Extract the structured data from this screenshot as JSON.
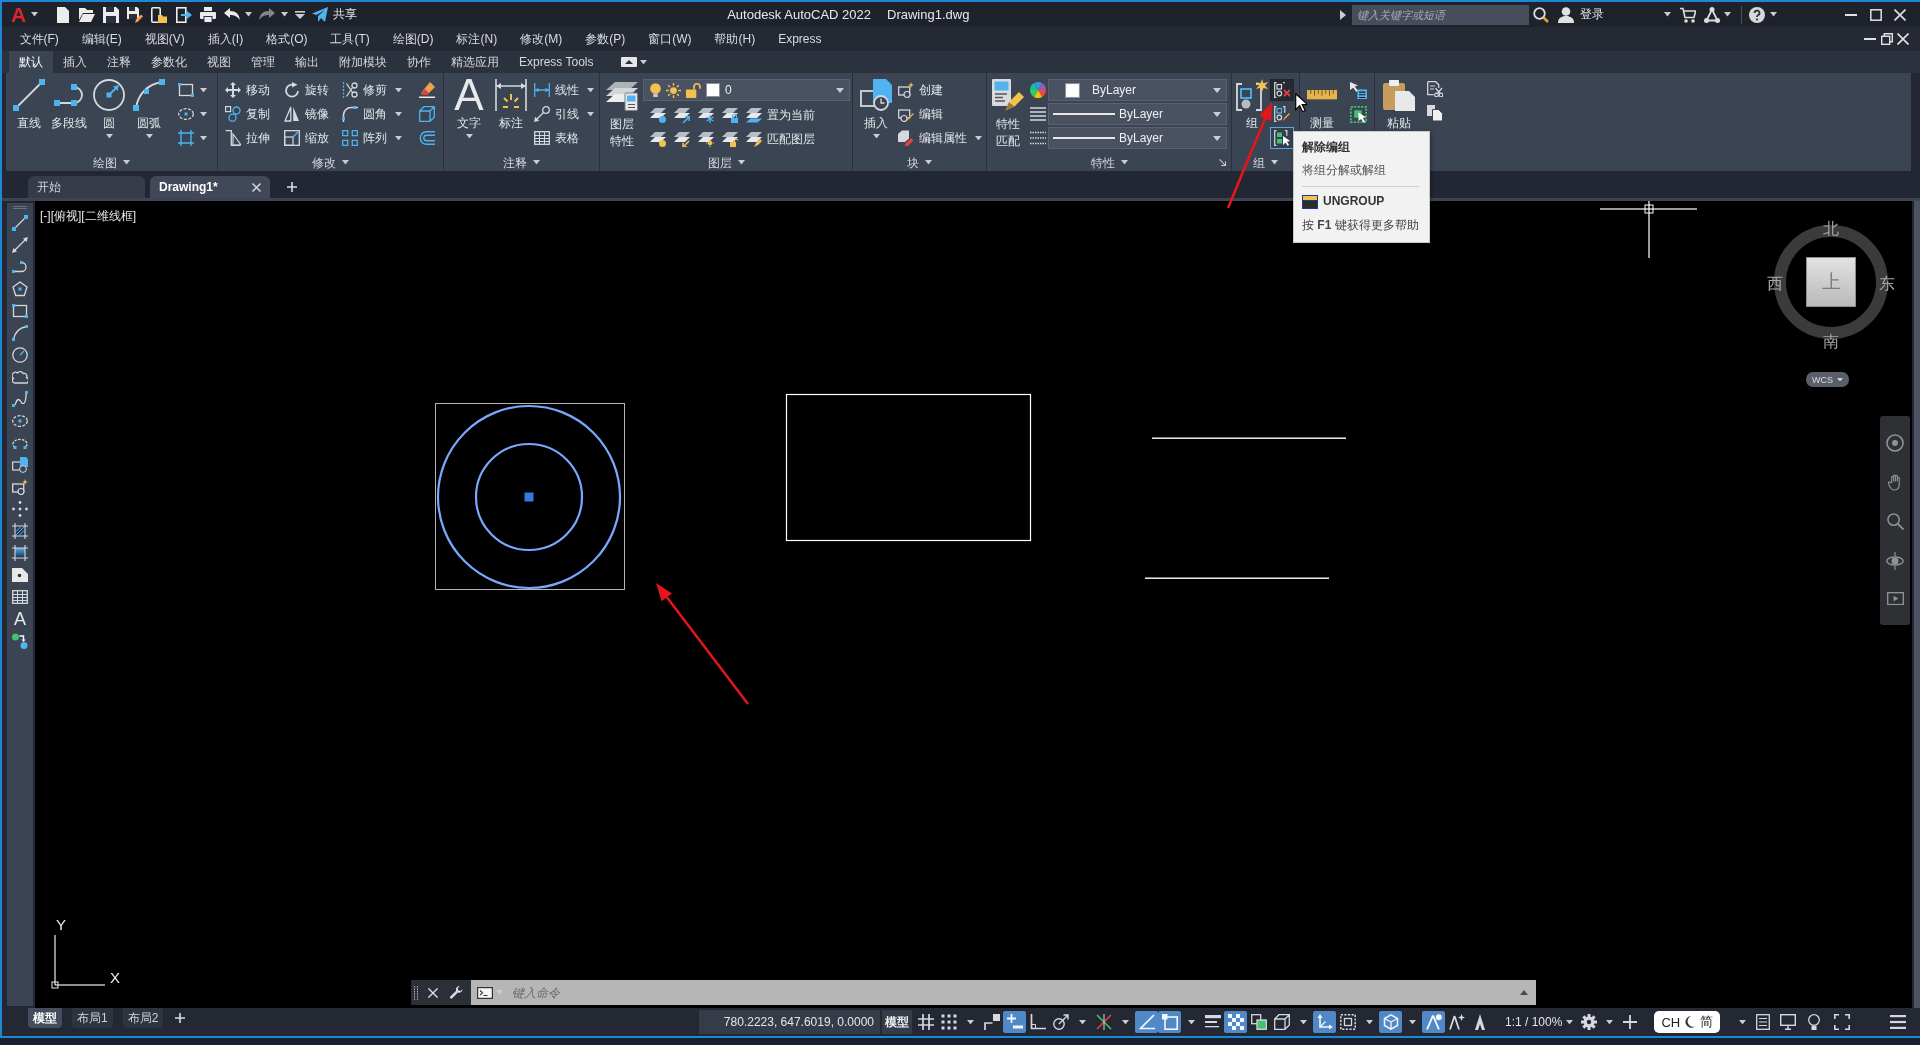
{
  "title_bar": {
    "logo": "A",
    "share_label": "共享",
    "app_title": "Autodesk AutoCAD 2022",
    "document_title": "Drawing1.dwg",
    "search": {
      "placeholder": "键入关键字或短语"
    },
    "sign_in": "登录"
  },
  "menu_bar": [
    "文件(F)",
    "编辑(E)",
    "视图(V)",
    "插入(I)",
    "格式(O)",
    "工具(T)",
    "绘图(D)",
    "标注(N)",
    "修改(M)",
    "参数(P)",
    "窗口(W)",
    "帮助(H)",
    "Express"
  ],
  "ribbon": {
    "tabs": [
      {
        "label": "默认",
        "selected": true
      },
      {
        "label": "插入",
        "selected": false
      },
      {
        "label": "注释",
        "selected": false
      },
      {
        "label": "参数化",
        "selected": false
      },
      {
        "label": "视图",
        "selected": false
      },
      {
        "label": "管理",
        "selected": false
      },
      {
        "label": "输出",
        "selected": false
      },
      {
        "label": "附加模块",
        "selected": false
      },
      {
        "label": "协作",
        "selected": false
      },
      {
        "label": "精选应用",
        "selected": false
      },
      {
        "label": "Express Tools",
        "selected": false
      }
    ],
    "draw": {
      "title": "绘图",
      "tools": [
        {
          "label": "直线",
          "dropdown": false
        },
        {
          "label": "多段线",
          "dropdown": false
        },
        {
          "label": "圆",
          "dropdown": true
        },
        {
          "label": "圆弧",
          "dropdown": true
        }
      ]
    },
    "modify": {
      "title": "修改",
      "tools": [
        {
          "label": "移动",
          "dropdown": false
        },
        {
          "label": "旋转",
          "dropdown": false
        },
        {
          "label": "修剪",
          "dropdown": true
        },
        {
          "label": "复制",
          "dropdown": false
        },
        {
          "label": "镜像",
          "dropdown": false
        },
        {
          "label": "圆角",
          "dropdown": true
        },
        {
          "label": "拉伸",
          "dropdown": false
        },
        {
          "label": "缩放",
          "dropdown": false
        },
        {
          "label": "阵列",
          "dropdown": true
        }
      ]
    },
    "annotation": {
      "title": "注释",
      "text_tool": {
        "glyph": "A",
        "label": "文字",
        "dropdown": true
      },
      "dimension_tool": {
        "label": "标注",
        "dropdown": false
      },
      "tools": [
        {
          "label": "线性",
          "dropdown": true
        },
        {
          "label": "引线",
          "dropdown": true
        },
        {
          "label": "表格",
          "dropdown": false
        }
      ]
    },
    "layers": {
      "title": "图层",
      "properties_tool": "图层特性",
      "current_layer": "0",
      "tools": [
        "置为当前",
        "匹配图层"
      ]
    },
    "block": {
      "title": "块",
      "insert_tool": {
        "label": "插入",
        "dropdown": true
      },
      "tools": [
        {
          "label": "创建",
          "dropdown": false
        },
        {
          "label": "编辑",
          "dropdown": false
        },
        {
          "label": "编辑属性",
          "dropdown": true
        }
      ]
    },
    "properties": {
      "title": "特性",
      "match_tool": "特性匹配",
      "object_color": "ByLayer",
      "linetype": "ByLayer",
      "lineweight": "ByLayer"
    },
    "groups": {
      "title": "组",
      "group_tool": "组",
      "tools": [
        {
          "hovered": true,
          "on": false
        },
        {
          "hovered": false,
          "on": false
        },
        {
          "hovered": false,
          "on": true
        }
      ]
    },
    "utilities": {
      "measure_tool": "测量"
    },
    "clipboard": {
      "paste_tool": "粘贴"
    }
  },
  "tooltip": {
    "title": "解除编组",
    "description": "将组分解或解组",
    "command": "UNGROUP",
    "help": "按 **F1** 键获得更多帮助"
  },
  "document_tabs": [
    {
      "label": "开始",
      "selected": false
    },
    {
      "label": "Drawing1*",
      "selected": true
    }
  ],
  "left_toolbar": {
    "text_tool": "A"
  },
  "viewport": {
    "controls": [
      "[-]",
      "[俯视]",
      "[二维线框]"
    ],
    "group_selected": true,
    "viewcube": {
      "north": "北",
      "south": "南",
      "west": "西",
      "east": "东",
      "face": "上",
      "coordinate_system": "WCS"
    },
    "ucs": {
      "x": "X",
      "y": "Y"
    }
  },
  "command_line": {
    "placeholder": "键入命令"
  },
  "status_bar": {
    "layout_tabs": [
      {
        "label": "模型",
        "selected": true
      },
      {
        "label": "布局1",
        "selected": false
      },
      {
        "label": "布局2",
        "selected": false
      }
    ],
    "coordinates": "780.2223, 647.6019, 0.0000",
    "space": "模型",
    "toggles": [
      {
        "on": false,
        "dropdown": false
      },
      {
        "on": false,
        "dropdown": true
      },
      {
        "on": false,
        "dropdown": false
      },
      {
        "on": true,
        "dropdown": false
      },
      {
        "on": false,
        "dropdown": false
      },
      {
        "on": false,
        "dropdown": true
      },
      {
        "on": false,
        "dropdown": true
      },
      {
        "on": true,
        "dropdown": false
      },
      {
        "on": true,
        "dropdown": true
      },
      {
        "on": false,
        "dropdown": false
      },
      {
        "on": true,
        "dropdown": false
      },
      {
        "on": false,
        "dropdown": false
      },
      {
        "on": false,
        "dropdown": true
      },
      {
        "on": true,
        "dropdown": false
      },
      {
        "on": false,
        "dropdown": true
      },
      {
        "on": true,
        "dropdown": true
      },
      {
        "on": true,
        "dropdown": false
      },
      {
        "on": false,
        "dropdown": false
      },
      {
        "on": false,
        "dropdown": false
      }
    ],
    "annotation_scale": "1:1 / 100%",
    "ime": {
      "language": "CH",
      "mode": "简"
    }
  }
}
